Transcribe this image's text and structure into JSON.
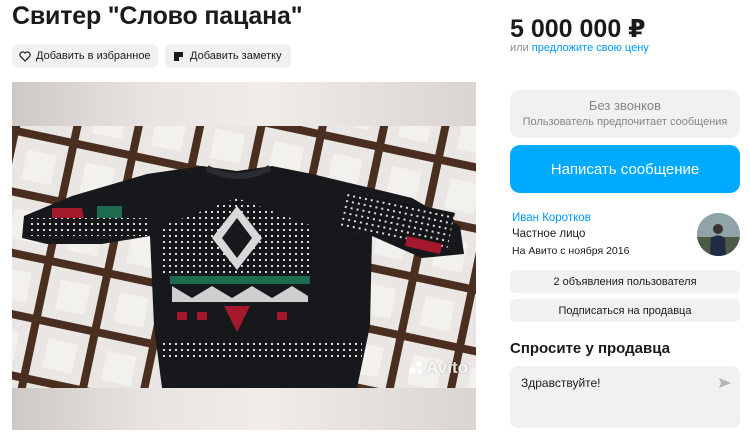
{
  "listing": {
    "title": "Свитер \"Слово пацана\"",
    "actions": {
      "favorite_label": "Добавить в избранное",
      "note_label": "Добавить заметку"
    },
    "gallery": {
      "watermark": "Avito"
    }
  },
  "sidebar": {
    "price": "5 000 000 ₽",
    "offer_prefix": "или ",
    "offer_link": "предложите свою цену",
    "no_calls": {
      "title": "Без звонков",
      "subtitle": "Пользователь предпочитает сообщения"
    },
    "message_button": "Написать сообщение",
    "seller": {
      "name": "Иван Коротков",
      "type": "Частное лицо",
      "since": "На Авито с ноября 2016"
    },
    "ads_count_label": "2 объявления пользователя",
    "subscribe_label": "Подписаться на продавца",
    "ask": {
      "title": "Спросите у продавца",
      "message": "Здравствуйте!"
    }
  },
  "colors": {
    "accent": "#00aaff",
    "link": "#0099f7",
    "chip_bg": "#f2f1f0"
  },
  "icons": [
    "heart-icon",
    "note-icon",
    "send-icon",
    "avito-logo"
  ]
}
